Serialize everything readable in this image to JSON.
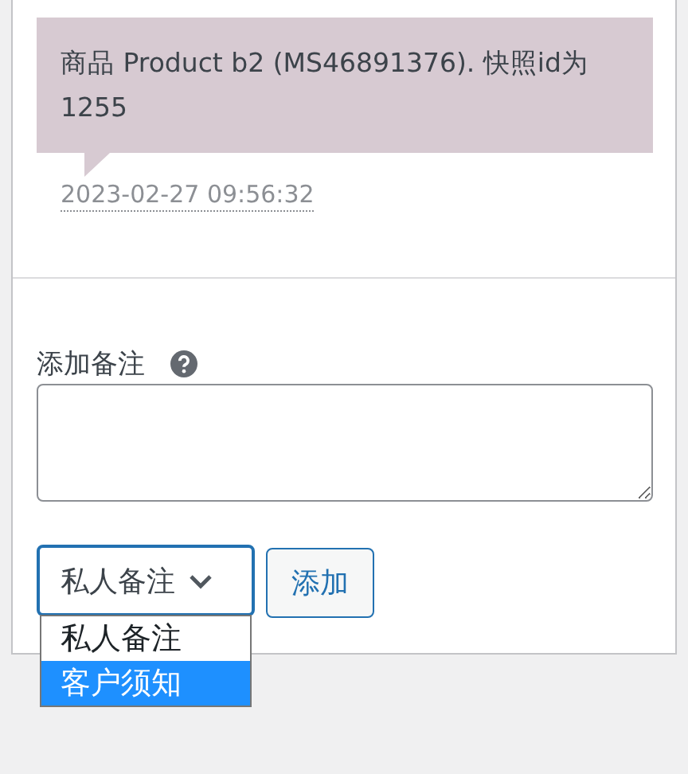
{
  "note": {
    "text": "商品 Product b2 (MS46891376). 快照id为 1255",
    "timestamp": "2023-02-27 09:56:32"
  },
  "add_note": {
    "label": "添加备注",
    "note_type": {
      "value": "私人备注",
      "expanded": true,
      "options": [
        {
          "label": "私人备注",
          "selected": true,
          "highlighted": false
        },
        {
          "label": "客户须知",
          "selected": false,
          "highlighted": true
        }
      ]
    },
    "button": "添加"
  }
}
